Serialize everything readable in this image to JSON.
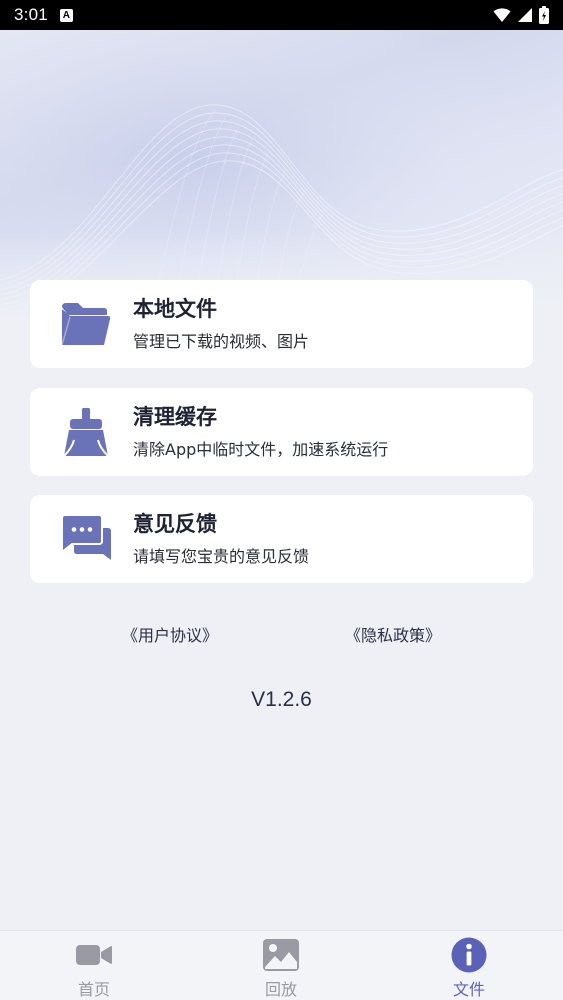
{
  "status_bar": {
    "time": "3:01",
    "notification_icon": "A"
  },
  "cards": [
    {
      "title": "本地文件",
      "subtitle": "管理已下载的视频、图片",
      "icon": "folder-icon"
    },
    {
      "title": "清理缓存",
      "subtitle": "清除App中临时文件，加速系统运行",
      "icon": "broom-icon"
    },
    {
      "title": "意见反馈",
      "subtitle": "请填写您宝贵的意见反馈",
      "icon": "chat-icon"
    }
  ],
  "links": {
    "user_agreement": "《用户协议》",
    "privacy_policy": "《隐私政策》"
  },
  "version": "V1.2.6",
  "tabs": [
    {
      "label": "首页",
      "icon": "video-camera-icon",
      "active": false
    },
    {
      "label": "回放",
      "icon": "image-icon",
      "active": false
    },
    {
      "label": "文件",
      "icon": "info-icon",
      "active": true
    }
  ],
  "colors": {
    "accent": "#5a62b8",
    "icon": "#6a72b8",
    "inactive": "#9a9aa4"
  }
}
